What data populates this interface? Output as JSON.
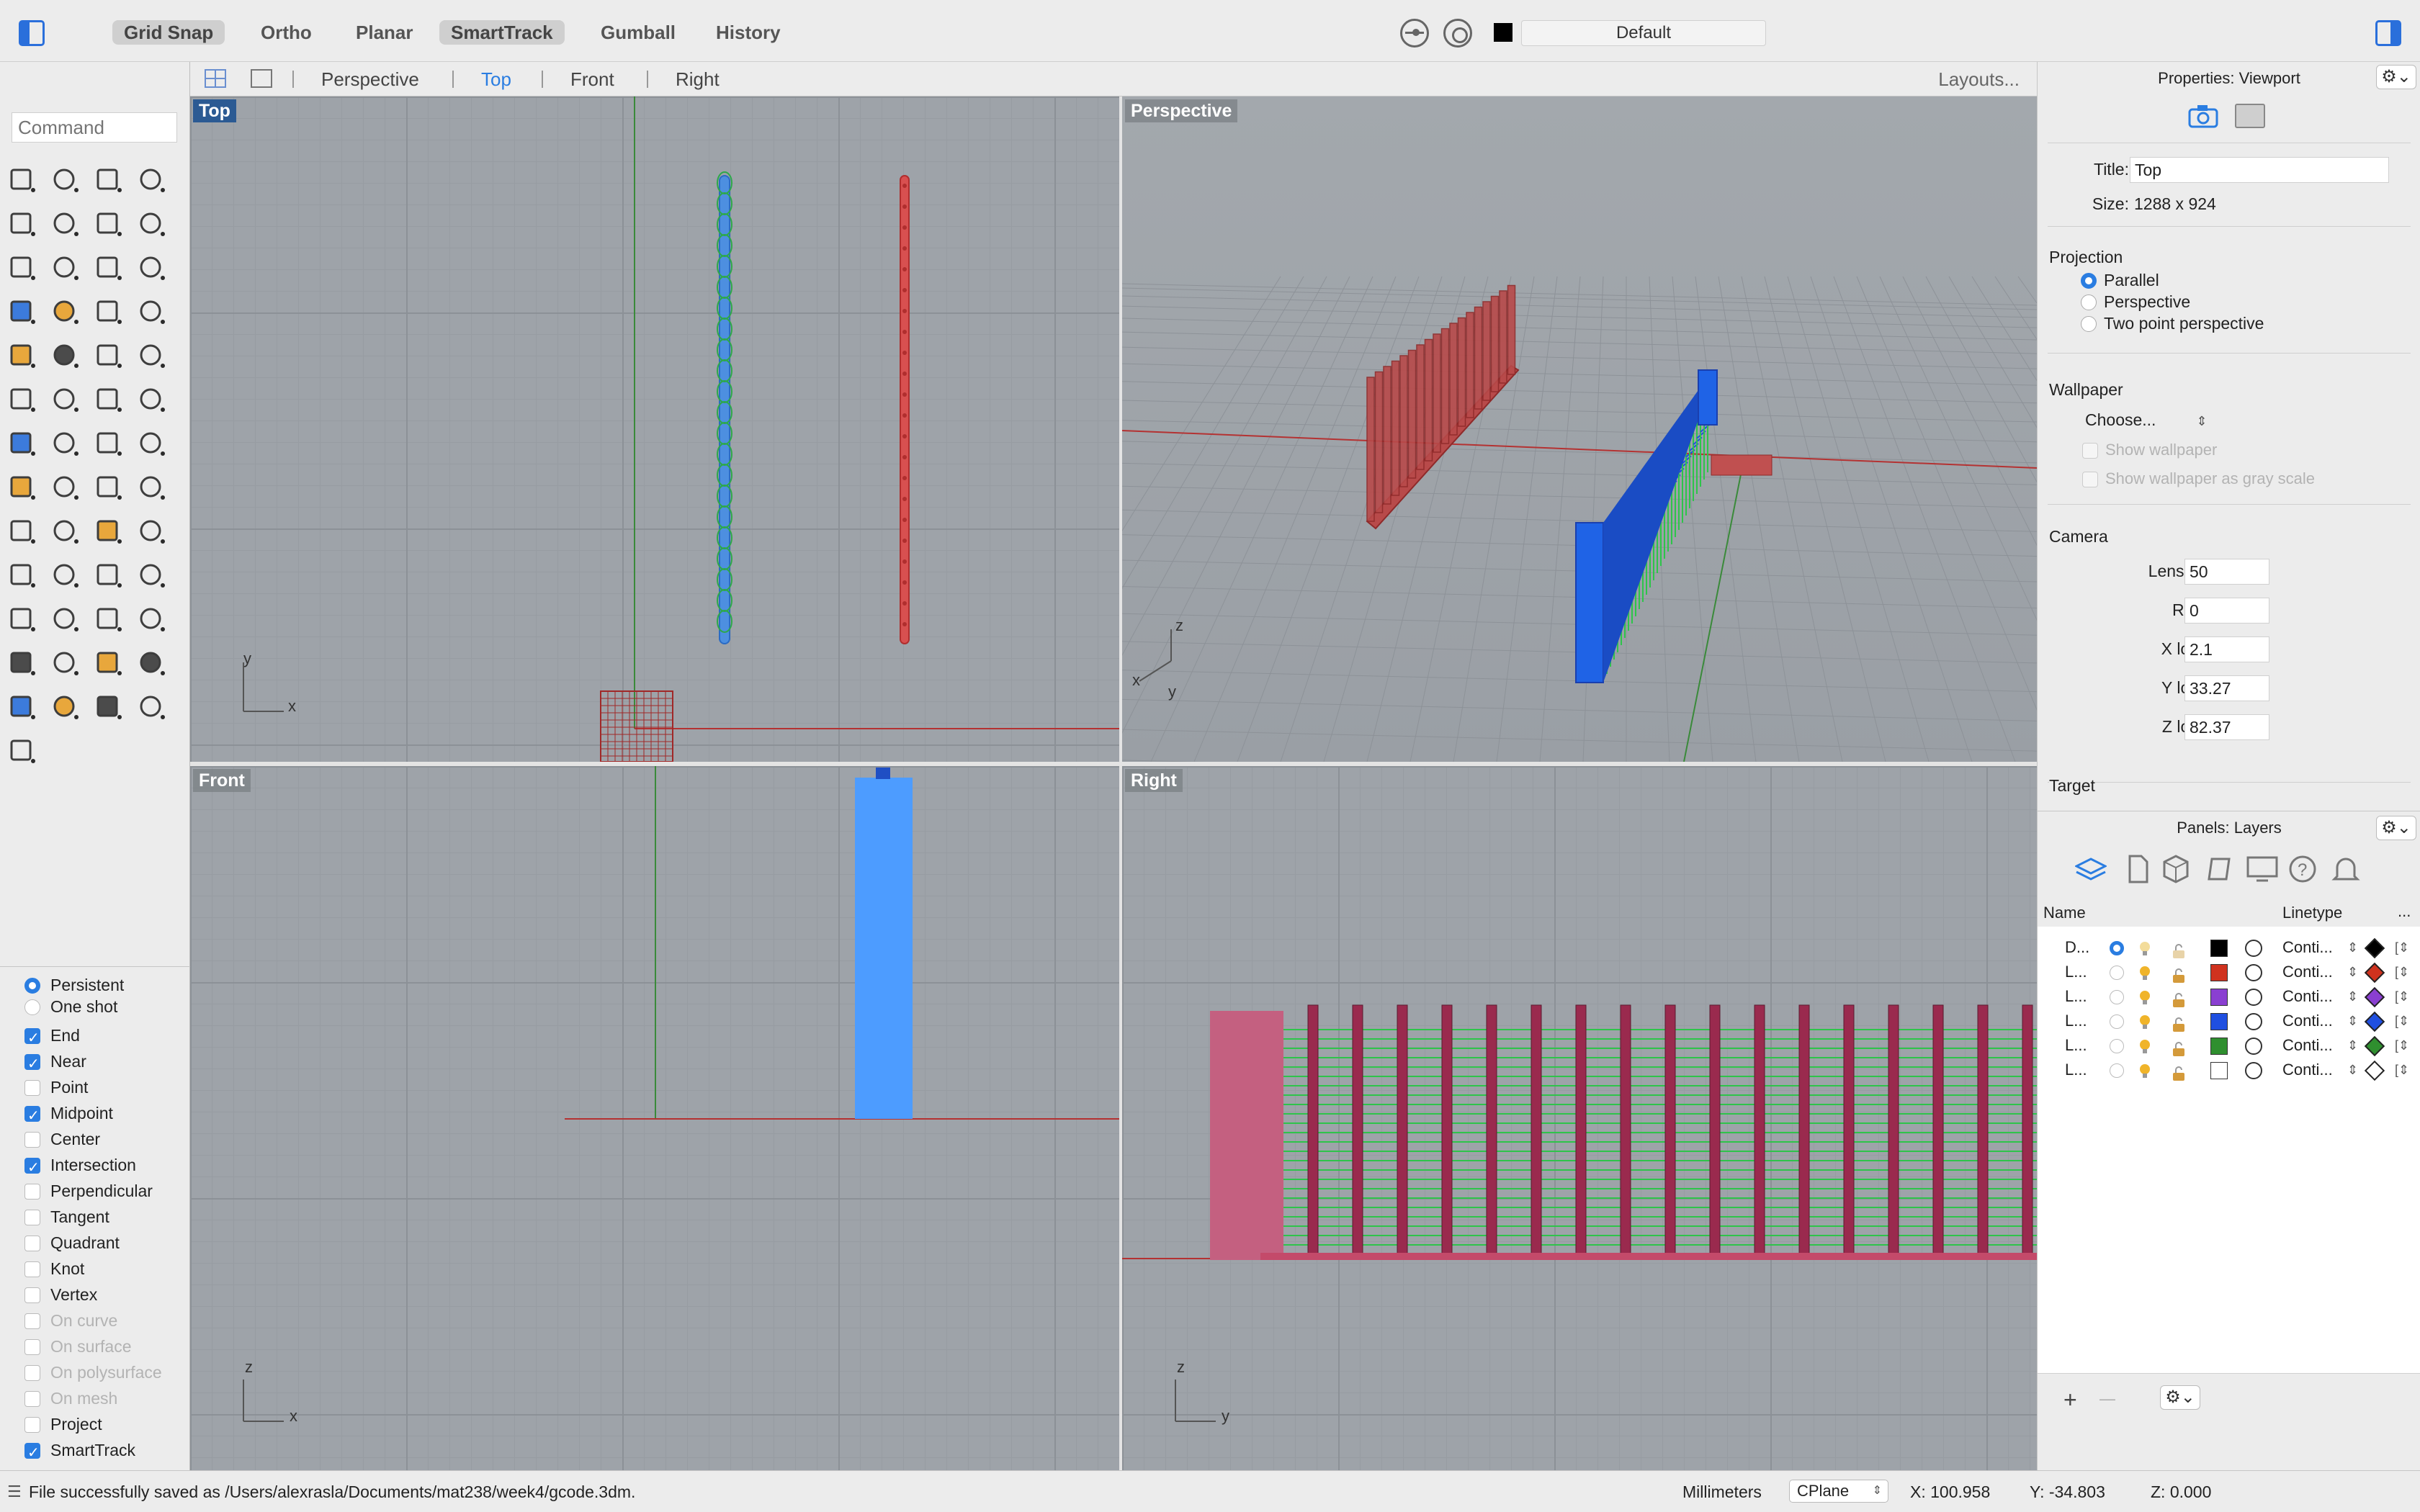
{
  "toolbar": {
    "modes": [
      {
        "label": "Grid Snap",
        "active": true
      },
      {
        "label": "Ortho",
        "active": false
      },
      {
        "label": "Planar",
        "active": false
      },
      {
        "label": "SmartTrack",
        "active": true
      },
      {
        "label": "Gumball",
        "active": false
      },
      {
        "label": "History",
        "active": false
      }
    ],
    "current_layer": "Default",
    "current_layer_color": "#000000"
  },
  "viewport_tabs": {
    "tabs": [
      "Perspective",
      "Top",
      "Front",
      "Right"
    ],
    "active": "Top",
    "layouts_label": "Layouts..."
  },
  "command": {
    "placeholder": "Command"
  },
  "osnap": {
    "mode_options": [
      {
        "label": "Persistent",
        "selected": true
      },
      {
        "label": "One shot",
        "selected": false
      }
    ],
    "snaps": [
      {
        "label": "End",
        "checked": true,
        "enabled": true
      },
      {
        "label": "Near",
        "checked": true,
        "enabled": true
      },
      {
        "label": "Point",
        "checked": false,
        "enabled": true
      },
      {
        "label": "Midpoint",
        "checked": true,
        "enabled": true
      },
      {
        "label": "Center",
        "checked": false,
        "enabled": true
      },
      {
        "label": "Intersection",
        "checked": true,
        "enabled": true
      },
      {
        "label": "Perpendicular",
        "checked": false,
        "enabled": true
      },
      {
        "label": "Tangent",
        "checked": false,
        "enabled": true
      },
      {
        "label": "Quadrant",
        "checked": false,
        "enabled": true
      },
      {
        "label": "Knot",
        "checked": false,
        "enabled": true
      },
      {
        "label": "Vertex",
        "checked": false,
        "enabled": true
      },
      {
        "label": "On curve",
        "checked": false,
        "enabled": false
      },
      {
        "label": "On surface",
        "checked": false,
        "enabled": false
      },
      {
        "label": "On polysurface",
        "checked": false,
        "enabled": false
      },
      {
        "label": "On mesh",
        "checked": false,
        "enabled": false
      },
      {
        "label": "Project",
        "checked": false,
        "enabled": true
      },
      {
        "label": "SmartTrack",
        "checked": true,
        "enabled": true
      }
    ]
  },
  "viewports": {
    "top": {
      "label": "Top",
      "axis_x": "x",
      "axis_y": "y"
    },
    "perspective": {
      "label": "Perspective",
      "axis_x": "x",
      "axis_y": "y",
      "axis_z": "z"
    },
    "front": {
      "label": "Front",
      "axis_x": "x",
      "axis_z": "z"
    },
    "right": {
      "label": "Right",
      "axis_y": "y",
      "axis_z": "z"
    }
  },
  "properties": {
    "header": "Properties: Viewport",
    "gear_label": "⚙︎⌄",
    "title_label": "Title:",
    "title_value": "Top",
    "size_label": "Size:",
    "size_value": "1288 x 924",
    "projection_label": "Projection",
    "projection_options": [
      {
        "label": "Parallel",
        "selected": true
      },
      {
        "label": "Perspective",
        "selected": false
      },
      {
        "label": "Two point perspective",
        "selected": false
      }
    ],
    "wallpaper_label": "Wallpaper",
    "wallpaper_choose": "Choose...",
    "show_wallpaper": "Show wallpaper",
    "show_wallpaper_gray": "Show wallpaper as gray scale",
    "camera_label": "Camera",
    "camera": [
      {
        "label": "Lens length:",
        "value": "50"
      },
      {
        "label": "Rotation:",
        "value": "0"
      },
      {
        "label": "X location:",
        "value": "2.1"
      },
      {
        "label": "Y location:",
        "value": "33.27"
      },
      {
        "label": "Z location:",
        "value": "82.37"
      }
    ],
    "target_label": "Target"
  },
  "layers_panel": {
    "header": "Panels: Layers",
    "col_name": "Name",
    "col_linetype": "Linetype",
    "col_more": "...",
    "rows": [
      {
        "name": "D...",
        "current": true,
        "color": "#000000",
        "linetype": "Conti...",
        "diamond": "#000000",
        "lit": false
      },
      {
        "name": "L...",
        "current": false,
        "color": "#d0321e",
        "linetype": "Conti...",
        "diamond": "#d0321e",
        "lit": true
      },
      {
        "name": "L...",
        "current": false,
        "color": "#8a3fd1",
        "linetype": "Conti...",
        "diamond": "#8a3fd1",
        "lit": true
      },
      {
        "name": "L...",
        "current": false,
        "color": "#1f4fe0",
        "linetype": "Conti...",
        "diamond": "#1f4fe0",
        "lit": true
      },
      {
        "name": "L...",
        "current": false,
        "color": "#2f8f2f",
        "linetype": "Conti...",
        "diamond": "#2f8f2f",
        "lit": true
      },
      {
        "name": "L...",
        "current": false,
        "color": "#ffffff",
        "linetype": "Conti...",
        "diamond": "#ffffff",
        "lit": true
      }
    ],
    "add_label": "+",
    "remove_label": "—",
    "gear_label": "⚙︎⌄"
  },
  "status": {
    "message": "File successfully saved as /Users/alexrasla/Documents/mat238/week4/gcode.3dm.",
    "units": "Millimeters",
    "cplane": "CPlane",
    "x": "X: 100.958",
    "y": "Y: -34.803",
    "z": "Z: 0.000"
  }
}
